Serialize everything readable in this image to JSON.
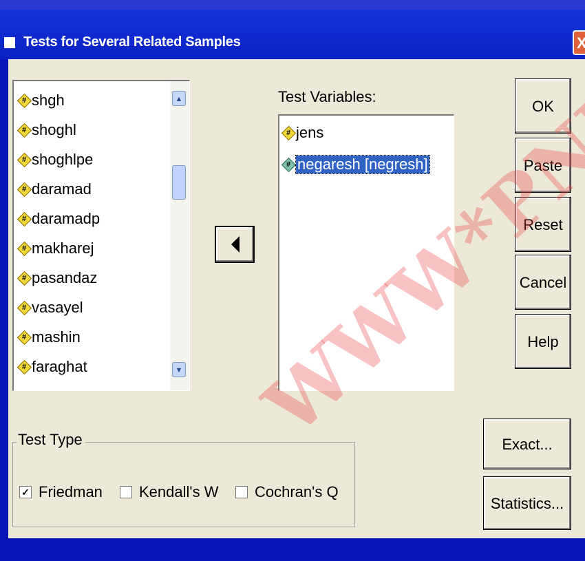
{
  "window": {
    "title": "Tests for Several Related Samples",
    "close_glyph": "X"
  },
  "source_list": {
    "items": [
      "shgh",
      "shoghl",
      "shoghlpe",
      "daramad",
      "daramadp",
      "makharej",
      "pasandaz",
      "vasayel",
      "mashin",
      "faraghat"
    ]
  },
  "test_variables": {
    "label": "Test Variables:",
    "items": [
      "jens",
      "negaresh [negresh]"
    ],
    "selected_index": 1
  },
  "buttons": {
    "ok": "OK",
    "paste": "Paste",
    "reset": "Reset",
    "cancel": "Cancel",
    "help": "Help",
    "exact": "Exact...",
    "statistics": "Statistics..."
  },
  "test_type": {
    "legend": "Test Type",
    "options": [
      {
        "label": "Friedman",
        "checked": true
      },
      {
        "label": "Kendall's W",
        "checked": false
      },
      {
        "label": "Cochran's Q",
        "checked": false
      }
    ]
  },
  "icons": {
    "variable": "scale-variable-icon",
    "move": "move-left-arrow-icon",
    "scroll_up": "scroll-up-icon",
    "scroll_down": "scroll-down-icon"
  },
  "watermark": "WWW*PNU"
}
